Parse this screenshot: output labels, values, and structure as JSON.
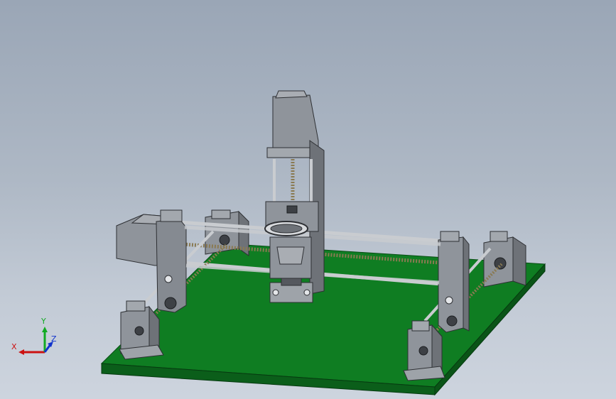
{
  "colors": {
    "background_top": "#9aa6b6",
    "background_bottom": "#cdd4de",
    "base_plate": "#0f7d22",
    "part_gray": "#8f949b",
    "part_dark": "#55585e",
    "rod": "#c9ccd0",
    "lead_screw": "#8a7a52",
    "axis_x": "#cc1111",
    "axis_y": "#11aa22",
    "axis_z": "#1133cc"
  },
  "triad": {
    "x_label": "X",
    "y_label": "Y",
    "z_label": "Z"
  }
}
